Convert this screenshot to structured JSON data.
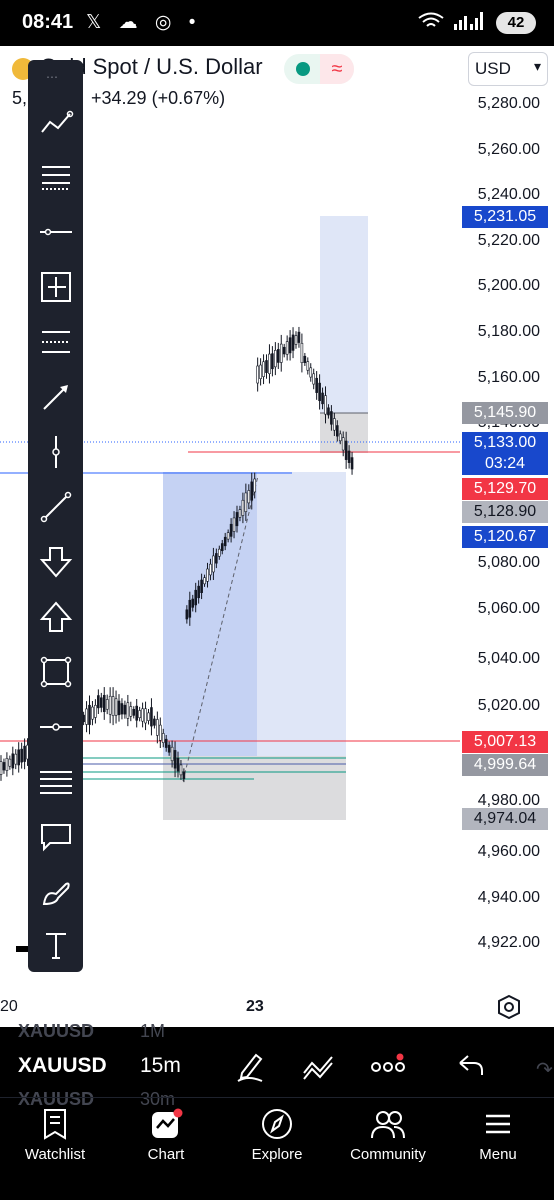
{
  "status_bar": {
    "time": "08:41",
    "icons": [
      "x-icon",
      "cloud-icon",
      "instagram-icon",
      "dot"
    ],
    "battery": "42"
  },
  "header": {
    "symbol_title": "Gold Spot / U.S. Dollar",
    "price_prefix": "5,",
    "change": "+34.29 (+0.67%)",
    "currency": "USD"
  },
  "price_scale": {
    "ticks": [
      "5,280.00",
      "5,260.00",
      "5,240.00",
      "5,220.00",
      "5,200.00",
      "5,180.00",
      "5,160.00",
      "5,140.00",
      "5,080.00",
      "5,060.00",
      "5,040.00",
      "5,020.00",
      "4,980.00",
      "4,960.00",
      "4,940.00",
      "4,922.00"
    ],
    "tags": [
      {
        "value": "5,231.05",
        "color": "#1848cc"
      },
      {
        "value": "5,145.90",
        "color": "#9598a1"
      },
      {
        "value": "5,133.00",
        "color": "#1848cc"
      },
      {
        "value": "03:24",
        "color": "#1848cc"
      },
      {
        "value": "5,129.70",
        "color": "#f23645"
      },
      {
        "value": "5,128.90",
        "color": "#b2b5be"
      },
      {
        "value": "5,120.67",
        "color": "#1848cc"
      },
      {
        "value": "5,007.13",
        "color": "#f23645"
      },
      {
        "value": "4,999.64",
        "color": "#9598a1"
      },
      {
        "value": "4,974.04",
        "color": "#b2b5be"
      }
    ]
  },
  "time_axis": {
    "labels": [
      "20",
      "23"
    ]
  },
  "toolbar": {
    "tools": [
      "trend-line-tool",
      "fib-retracement-tool",
      "horizontal-line-tool",
      "long-position-tool",
      "pitchfork-tool",
      "arrow-tool",
      "vertical-line-tool",
      "ray-tool",
      "arrow-down-tool",
      "arrow-up-tool",
      "rectangle-tool",
      "horizontal-ray-tool",
      "parallel-channel-tool",
      "callout-tool",
      "brush-tool",
      "text-tool"
    ]
  },
  "bottom": {
    "symbol": "XAUUSD",
    "interval": "15m",
    "ghost_prev_symbol": "XAUUSD",
    "ghost_prev_interval": "1M",
    "ghost_next_symbol": "XAUUSD",
    "ghost_next_interval": "30m"
  },
  "nav": [
    {
      "label": "Watchlist",
      "icon": "watchlist-icon"
    },
    {
      "label": "Chart",
      "icon": "chart-icon"
    },
    {
      "label": "Explore",
      "icon": "compass-icon"
    },
    {
      "label": "Community",
      "icon": "community-icon"
    },
    {
      "label": "Menu",
      "icon": "menu-icon"
    }
  ]
}
